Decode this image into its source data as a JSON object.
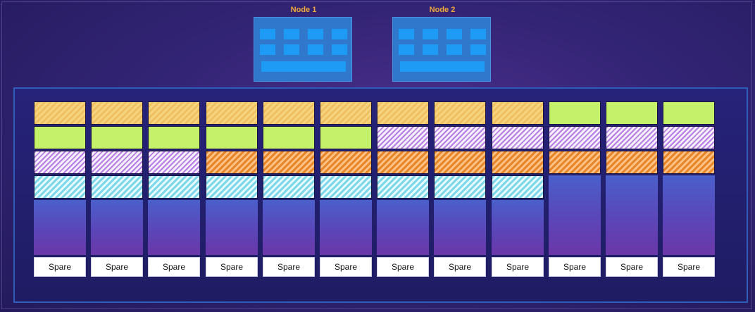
{
  "nodes": [
    {
      "label": "Node 1"
    },
    {
      "label": "Node 2"
    }
  ],
  "legend_colors": {
    "yellow": "#f6d47e",
    "green": "#c4f06a",
    "purple": "#b67ee6",
    "orange": "#e8872a",
    "cyan": "#7fd8ea",
    "node_blue": "#1e9bf5"
  },
  "columns": [
    {
      "slots": [
        "yellow",
        "green",
        "purple",
        "cyan"
      ],
      "spare_label": "Spare"
    },
    {
      "slots": [
        "yellow",
        "green",
        "purple",
        "cyan"
      ],
      "spare_label": "Spare"
    },
    {
      "slots": [
        "yellow",
        "green",
        "purple",
        "cyan"
      ],
      "spare_label": "Spare"
    },
    {
      "slots": [
        "yellow",
        "green",
        "orange",
        "cyan"
      ],
      "spare_label": "Spare"
    },
    {
      "slots": [
        "yellow",
        "green",
        "orange",
        "cyan"
      ],
      "spare_label": "Spare"
    },
    {
      "slots": [
        "yellow",
        "green",
        "orange",
        "cyan"
      ],
      "spare_label": "Spare"
    },
    {
      "slots": [
        "yellow",
        "purple",
        "orange",
        "cyan"
      ],
      "spare_label": "Spare"
    },
    {
      "slots": [
        "yellow",
        "purple",
        "orange",
        "cyan"
      ],
      "spare_label": "Spare"
    },
    {
      "slots": [
        "yellow",
        "purple",
        "orange",
        "cyan"
      ],
      "spare_label": "Spare"
    },
    {
      "slots": [
        "green",
        "purple",
        "orange"
      ],
      "spare_label": "Spare"
    },
    {
      "slots": [
        "green",
        "purple",
        "orange"
      ],
      "spare_label": "Spare"
    },
    {
      "slots": [
        "green",
        "purple",
        "orange"
      ],
      "spare_label": "Spare"
    }
  ]
}
